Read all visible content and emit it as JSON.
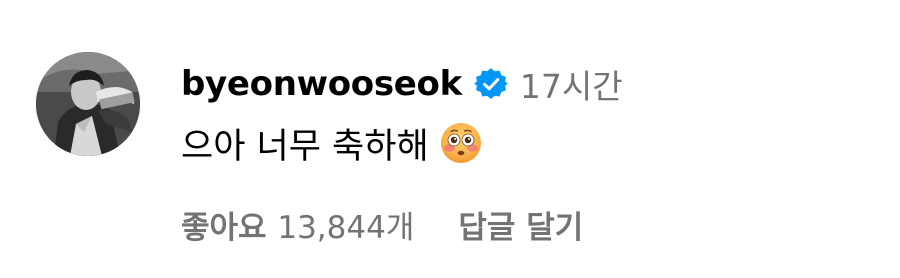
{
  "comment": {
    "avatar_icon": "profile-photo",
    "username": "byeonwooseok",
    "verified_icon": "verified-badge-icon",
    "verified_color": "#0095f6",
    "time": "17시간",
    "text": "으아 너무 축하해",
    "emoji_icon": "flushed-face-emoji",
    "likes_label": "좋아요",
    "likes_count": "13,844개",
    "reply_label": "답글 달기",
    "muted_color": "#737373"
  }
}
